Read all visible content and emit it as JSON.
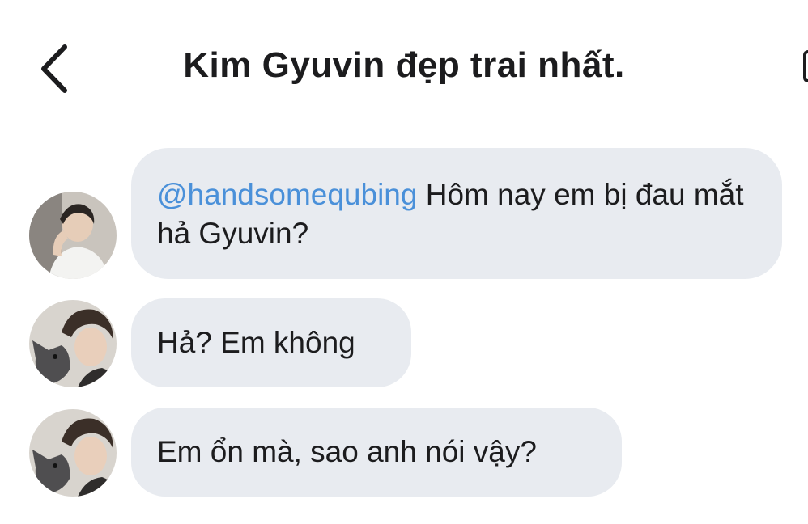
{
  "header": {
    "title": "Kim Gyuvin đẹp trai nhất."
  },
  "icons": {
    "back": "chevron-left-icon",
    "edge": "compose-icon"
  },
  "colors": {
    "bubble": "#e8ebf0",
    "mention": "#4a90d9",
    "text": "#1c1c1e"
  },
  "messages": [
    {
      "mention": "@handsomequbing",
      "text": " Hôm nay em bị đau mắt hả Gyuvin?"
    },
    {
      "text": "Hả? Em không"
    },
    {
      "text": "Em ổn mà, sao anh nói vậy?"
    }
  ]
}
